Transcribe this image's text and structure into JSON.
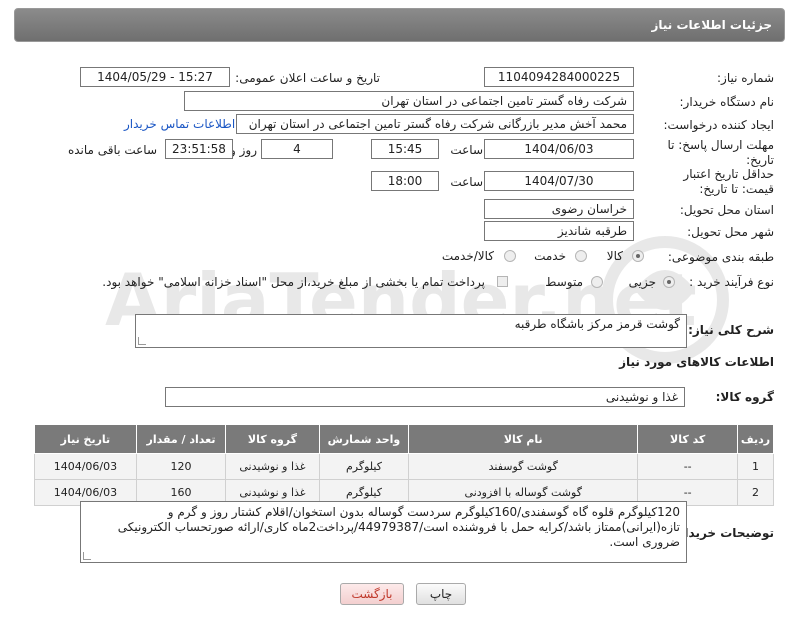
{
  "header": {
    "title": "جزئیات اطلاعات نیاز"
  },
  "labels": {
    "need_number": "شماره نیاز:",
    "announce_datetime": "تاریخ و ساعت اعلان عمومی:",
    "buyer_org": "نام دستگاه خریدار:",
    "requester": "ایجاد کننده درخواست:",
    "reply_deadline": "مهلت ارسال پاسخ: تا تاریخ:",
    "price_validity": "حداقل تاریخ اعتبار قیمت: تا تاریخ:",
    "delivery_province": "استان محل تحویل:",
    "delivery_city": "شهر محل تحویل:",
    "subject_class": "طبقه بندی موضوعی:",
    "purchase_type": "نوع فرآیند خرید :",
    "time": "ساعت",
    "days_and": "روز و",
    "remaining": "ساعت باقی مانده",
    "need_desc": "شرح کلی نیاز:",
    "goods_info": "اطلاعات کالاهای مورد نیاز",
    "goods_group": "گروه کالا:",
    "buyer_notes": "توضیحات خریدار:"
  },
  "values": {
    "need_number": "1104094284000225",
    "announce_datetime": "1404/05/29 - 15:27",
    "buyer_org": "شرکت رفاه گستر تامین اجتماعی در استان تهران",
    "requester": "محمد آخش مدیر بازرگانی شرکت رفاه گستر تامین اجتماعی در استان تهران",
    "buyer_contact_link": "اطلاعات تماس خریدار",
    "reply_date": "1404/06/03",
    "reply_time": "15:45",
    "days": "4",
    "remaining_time": "23:51:58",
    "price_date": "1404/07/30",
    "price_time": "18:00",
    "province": "خراسان رضوی",
    "city": "طرقبه شاندیز",
    "need_desc": "گوشت قرمز مرکز باشگاه طرقبه",
    "goods_group": "غذا و نوشیدنی",
    "buyer_notes": "120کیلوگرم قلوه گاه گوسفندی/160کیلوگرم سردست گوساله بدون استخوان/اقلام کشتار روز و گرم و تازه(ایرانی)ممتاز باشد/کرایه حمل با فروشنده است/44979387/پرداخت2ماه کاری/ارائه صورتحساب الکترونیکی ضروری است."
  },
  "subject_options": {
    "kala": "کالا",
    "khedmat": "خدمت",
    "kala_khedmat": "کالا/خدمت",
    "selected": "کالا"
  },
  "purchase_options": {
    "jozi": "جزیی",
    "motevaset": "متوسط",
    "selected": "جزیی",
    "payment_note": "پرداخت تمام یا بخشی از مبلغ خرید،از محل \"اسناد خزانه اسلامی\" خواهد بود."
  },
  "table": {
    "headers": [
      "ردیف",
      "کد کالا",
      "نام کالا",
      "واحد شمارش",
      "گروه کالا",
      "تعداد / مقدار",
      "تاریخ نیاز"
    ],
    "rows": [
      [
        "1",
        "--",
        "گوشت گوسفند",
        "کیلوگرم",
        "غذا و نوشیدنی",
        "120",
        "1404/06/03"
      ],
      [
        "2",
        "--",
        "گوشت گوساله با افزودنی",
        "کیلوگرم",
        "غذا و نوشیدنی",
        "160",
        "1404/06/03"
      ]
    ]
  },
  "buttons": {
    "print": "چاپ",
    "back": "بازگشت"
  },
  "watermark": {
    "text": "AriaTender.net"
  },
  "colors": {
    "header_bg": "#7a7a7a",
    "link": "#1a56c4",
    "back_text": "#c0392b"
  }
}
